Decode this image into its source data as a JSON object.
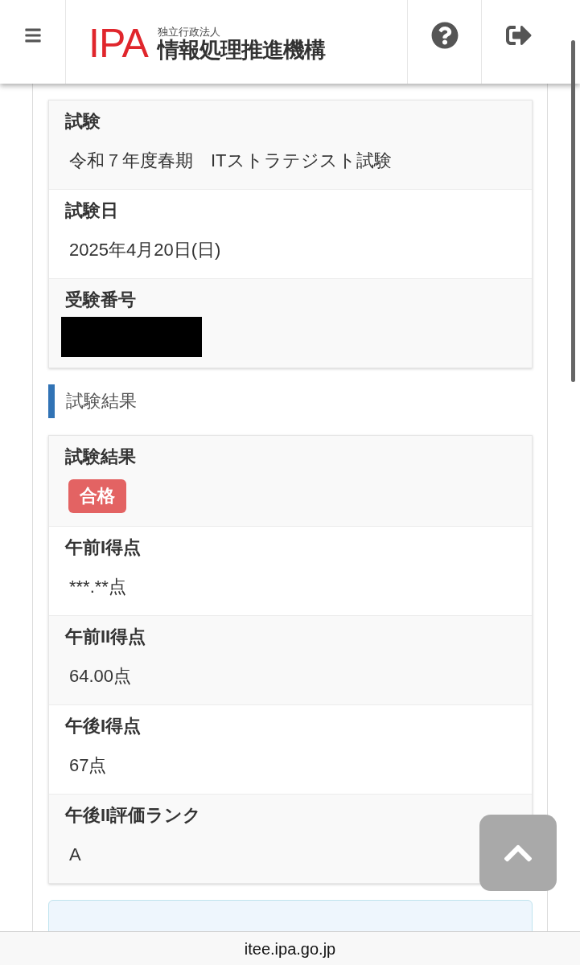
{
  "header": {
    "logo": {
      "mark": "IPA",
      "subtitle": "独立行政法人",
      "name": "情報処理推進機構"
    }
  },
  "exam_info": {
    "fields": [
      {
        "kind": "text",
        "label": "試験",
        "value": "令和７年度春期　ITストラテジスト試験"
      },
      {
        "kind": "text",
        "label": "試験日",
        "value": "2025年4月20日(日)"
      },
      {
        "kind": "redacted",
        "label": "受験番号"
      }
    ]
  },
  "results": {
    "heading": "試験結果",
    "fields": [
      {
        "kind": "badge",
        "label": "試験結果",
        "value": "合格"
      },
      {
        "kind": "text",
        "label": "午前I得点",
        "value": "***.**点"
      },
      {
        "kind": "text",
        "label": "午前II得点",
        "value": "64.00点"
      },
      {
        "kind": "text",
        "label": "午後I得点",
        "value": "67点"
      },
      {
        "kind": "text",
        "label": "午後II評価ランク",
        "value": "A"
      }
    ]
  },
  "browser_bar": {
    "url": "itee.ipa.go.jp"
  }
}
